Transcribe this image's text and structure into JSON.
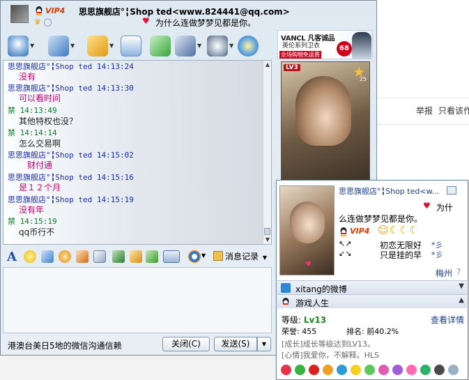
{
  "background_page": {
    "report_label": "举报",
    "view_only_label": "只看该作"
  },
  "chat_window": {
    "title": {
      "vip_label": "VIP4",
      "contact_name": "思思旗舰店°╏Shop ted<www.824441@qq.com>",
      "signature": "为什么连做梦梦见都是你。"
    },
    "toolbar": {
      "icons": [
        "video-call-icon",
        "voice-call-icon",
        "send-file-icon",
        "send-mail-icon",
        "add-app-icon",
        "contact-card-icon",
        "settings-icon",
        "qzone-icon"
      ]
    },
    "messages": [
      {
        "sender": "思思旗舰店°╏Shop ted",
        "time": "14:13:24",
        "text": "没有",
        "side": "contact"
      },
      {
        "sender": "思思旗舰店°╏Shop ted",
        "time": "14:13:30",
        "text": "可以看时间",
        "side": "contact"
      },
      {
        "sender": "禁",
        "time": "14:13:49",
        "text": "其他特权也没？",
        "side": "self"
      },
      {
        "sender": "禁",
        "time": "14:14:14",
        "text": "怎么交易啊",
        "side": "self"
      },
      {
        "sender": "思思旗舰店°╏Shop ted",
        "time": "14:15:02",
        "text": "财付通",
        "side": "contact"
      },
      {
        "sender": "思思旗舰店°╏Shop ted",
        "time": "14:15:16",
        "text": "是１２个月",
        "side": "contact"
      },
      {
        "sender": "思思旗舰店°╏Shop ted",
        "time": "14:15:19",
        "text": "没有年",
        "side": "contact"
      },
      {
        "sender": "禁",
        "time": "14:15:19",
        "text": "qq币行不",
        "side": "self"
      }
    ],
    "input_toolbar": {
      "font_label": "A",
      "message_record_label": "消息记录"
    },
    "status_text": "港澳台美日5地的微信沟通信赖",
    "close_button": "关闭(C)",
    "send_button": "发送(S)"
  },
  "ad": {
    "brand": "VANCL 凡客诚品",
    "line2": "英伦系列卫衣",
    "line3": "全场购物免运费",
    "price": "68"
  },
  "photo": {
    "level_badge": "LV3",
    "count": "25"
  },
  "profile_popup": {
    "name": "思思旗舰店°╏Shop ted<w...",
    "heart_text": "为什",
    "signature": "么连做梦梦见都是你。",
    "vip_label": "VIP4",
    "status_line1": "初恋无限好",
    "status_line2": "只是挂的早",
    "star_marks": "*彡",
    "location": "梅州",
    "weibo_label": "xitang的微博",
    "game_label": "游戏人生",
    "game_level_label": "等级:",
    "game_level_value": "Lv13",
    "game_detail_link": "查看详情",
    "honor_label": "荣誉: 455",
    "rank_label": "排名: 前40.2%",
    "growth_text": "[成长]成长等级达到LV13。",
    "mood_text": "[心情]我爱你，不解释。HLS"
  },
  "colors": {
    "contact_name": "#1a2ea8",
    "self_name": "#0d7a2c",
    "contact_message": "#c30070",
    "link": "#1a3c8c",
    "vip": "#e03a00"
  }
}
